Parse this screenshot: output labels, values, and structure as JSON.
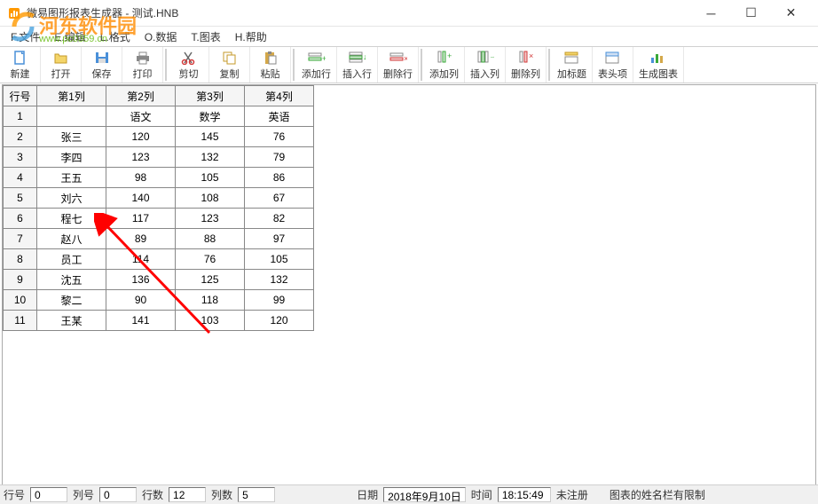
{
  "window": {
    "title": "微易图形报表生成器 - 测试.HNB"
  },
  "menu": {
    "file": "F.文件",
    "edit": "E.编辑",
    "format": "L.格式",
    "data": "O.数据",
    "chart": "T.图表",
    "help": "H.帮助"
  },
  "toolbar": {
    "new": "新建",
    "open": "打开",
    "save": "保存",
    "print": "打印",
    "cut": "剪切",
    "copy": "复制",
    "paste": "粘贴",
    "add_row": "添加行",
    "insert_row": "插入行",
    "delete_row": "删除行",
    "add_col": "添加列",
    "insert_col": "插入列",
    "delete_col": "删除列",
    "add_title": "加标题",
    "header": "表头项",
    "gen_chart": "生成图表"
  },
  "grid": {
    "rownum_header": "行号",
    "headers": [
      "第1列",
      "第2列",
      "第3列",
      "第4列"
    ],
    "rows": [
      {
        "n": "1",
        "c": [
          "",
          "语文",
          "数学",
          "英语"
        ]
      },
      {
        "n": "2",
        "c": [
          "张三",
          "120",
          "145",
          "76"
        ]
      },
      {
        "n": "3",
        "c": [
          "李四",
          "123",
          "132",
          "79"
        ]
      },
      {
        "n": "4",
        "c": [
          "王五",
          "98",
          "105",
          "86"
        ]
      },
      {
        "n": "5",
        "c": [
          "刘六",
          "140",
          "108",
          "67"
        ]
      },
      {
        "n": "6",
        "c": [
          "程七",
          "117",
          "123",
          "82"
        ]
      },
      {
        "n": "7",
        "c": [
          "赵八",
          "89",
          "88",
          "97"
        ]
      },
      {
        "n": "8",
        "c": [
          "员工",
          "114",
          "76",
          "105"
        ]
      },
      {
        "n": "9",
        "c": [
          "沈五",
          "136",
          "125",
          "132"
        ]
      },
      {
        "n": "10",
        "c": [
          "黎二",
          "90",
          "118",
          "99"
        ]
      },
      {
        "n": "11",
        "c": [
          "王某",
          "141",
          "103",
          "120"
        ]
      }
    ]
  },
  "status": {
    "row_label": "行号",
    "row_val": "0",
    "col_label": "列号",
    "col_val": "0",
    "rows_label": "行数",
    "rows_val": "12",
    "cols_label": "列数",
    "cols_val": "5",
    "date_label": "日期",
    "date_val": "2018年9月10日",
    "time_label": "时间",
    "time_val": "18:15:49",
    "reg": "未注册",
    "msg": "图表的姓名栏有限制"
  },
  "watermark": {
    "main": "河东软件园",
    "sub": "www.pc0359.cn"
  },
  "icon_colors": {
    "new": "#4a90d9",
    "open": "#d4a84a",
    "save": "#4a90d9",
    "print": "#888",
    "cut": "#888",
    "copy": "#d4a84a",
    "paste": "#d4a84a",
    "row_add": "#39a939",
    "row_ins": "#39a939",
    "row_del": "#d23838",
    "col_add": "#39a939",
    "col_ins": "#39a939",
    "col_del": "#d23838",
    "title": "#d4a84a",
    "header_i": "#4a90d9",
    "chart": "#39a939"
  }
}
